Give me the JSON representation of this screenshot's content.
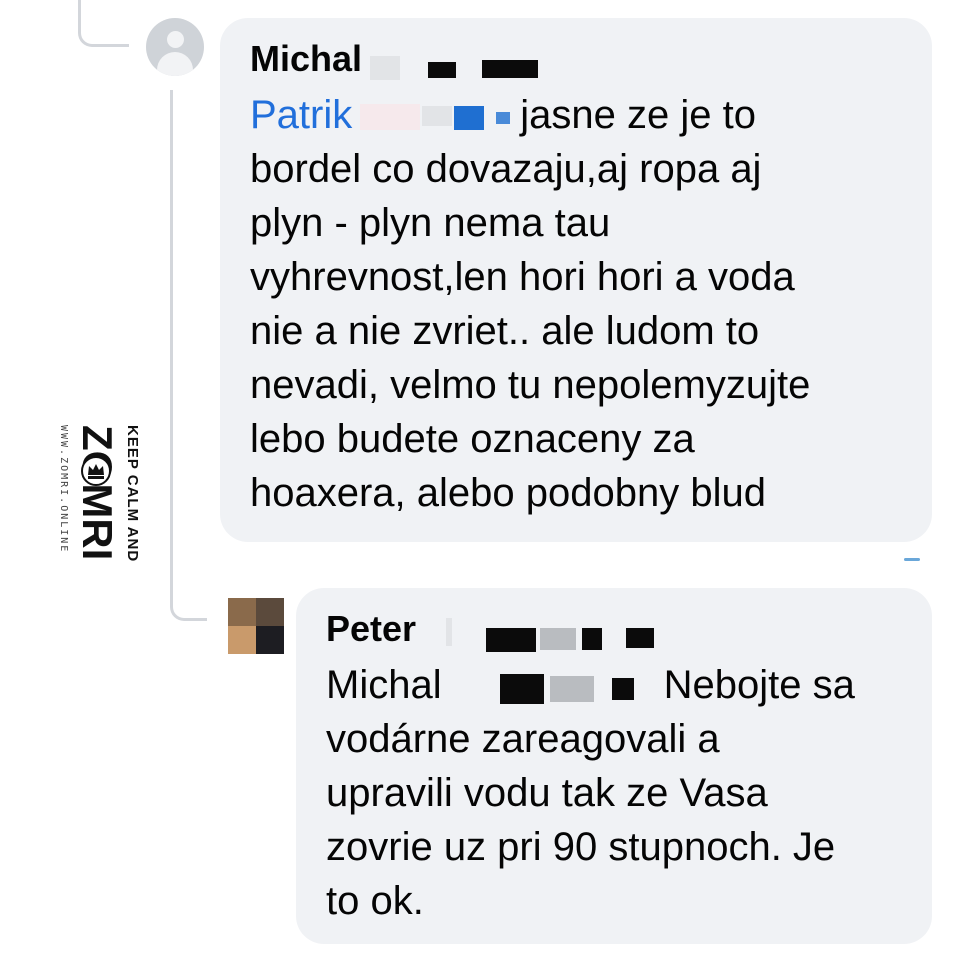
{
  "comments": [
    {
      "author": "Michal",
      "mention": "Patrik",
      "lines": [
        "jasne ze je to",
        "bordel co dovazaju,aj ropa aj",
        "plyn - plyn nema tau",
        "vyhrevnost,len hori hori a voda",
        "nie a nie zvriet.. ale ludom to",
        "nevadi, velmo tu nepolemyzujte",
        "lebo budete oznaceny za",
        "hoaxera, alebo podobny blud"
      ]
    },
    {
      "author": "Peter",
      "mention": "Michal",
      "lines": [
        "Nebojte sa",
        "vodárne zareagovali a",
        "upravili vodu tak ze Vasa",
        "zovrie uz pri 90 stupnoch. Je",
        "to ok."
      ]
    }
  ],
  "watermark": {
    "tagline": "KEEP CALM AND",
    "brand": "ZOMRI",
    "url": "WWW.ZOMRI.ONLINE"
  },
  "icons": {
    "default_avatar": "default-profile-avatar-icon",
    "photo_avatar": "pixelated-profile-photo",
    "crown": "crown-icon"
  },
  "colors": {
    "bubble": "#f0f2f5",
    "mention": "#216fdb",
    "thread_line": "#d3d6db"
  }
}
